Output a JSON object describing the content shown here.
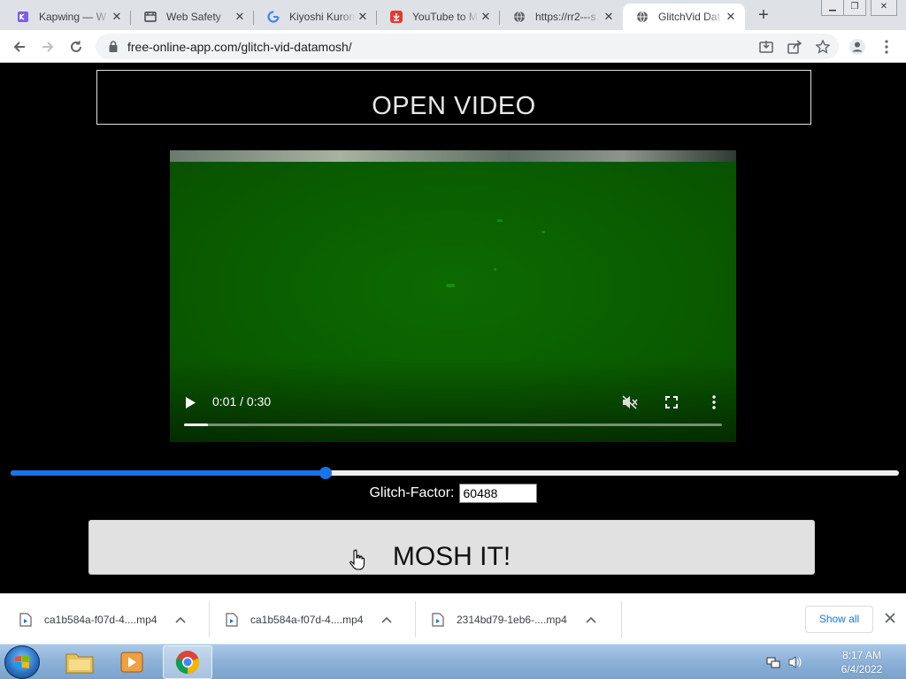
{
  "browser": {
    "tabs": [
      {
        "label": "Kapwing — W",
        "icon": "kapwing-icon"
      },
      {
        "label": "Web Safety",
        "icon": "web-safety-icon"
      },
      {
        "label": "Kiyoshi Kuron",
        "icon": "google-icon"
      },
      {
        "label": "YouTube to M",
        "icon": "download-icon"
      },
      {
        "label": "https://rr2---s",
        "icon": "globe-icon"
      },
      {
        "label": "GlitchVid Dat",
        "icon": "globe-icon",
        "active": true
      }
    ],
    "url": "free-online-app.com/glitch-vid-datamosh/"
  },
  "page": {
    "open_label": "OPEN VIDEO",
    "video": {
      "time": "0:01 / 0:30",
      "progress": 0.045
    },
    "glitch": {
      "label": "Glitch-Factor:",
      "value": "60488",
      "slider_fraction": 0.355
    },
    "mosh_label": "MOSH IT!"
  },
  "downloads": {
    "items": [
      {
        "name": "ca1b584a-f07d-4....mp4"
      },
      {
        "name": "ca1b584a-f07d-4....mp4"
      },
      {
        "name": "2314bd79-1eb6-....mp4"
      }
    ],
    "show_all": "Show all"
  },
  "taskbar": {
    "time": "8:17 AM",
    "date": "6/4/2022"
  },
  "colors": {
    "accent": "#1a73e8",
    "video_green": "#0a5a00",
    "page_bg": "#000000"
  }
}
